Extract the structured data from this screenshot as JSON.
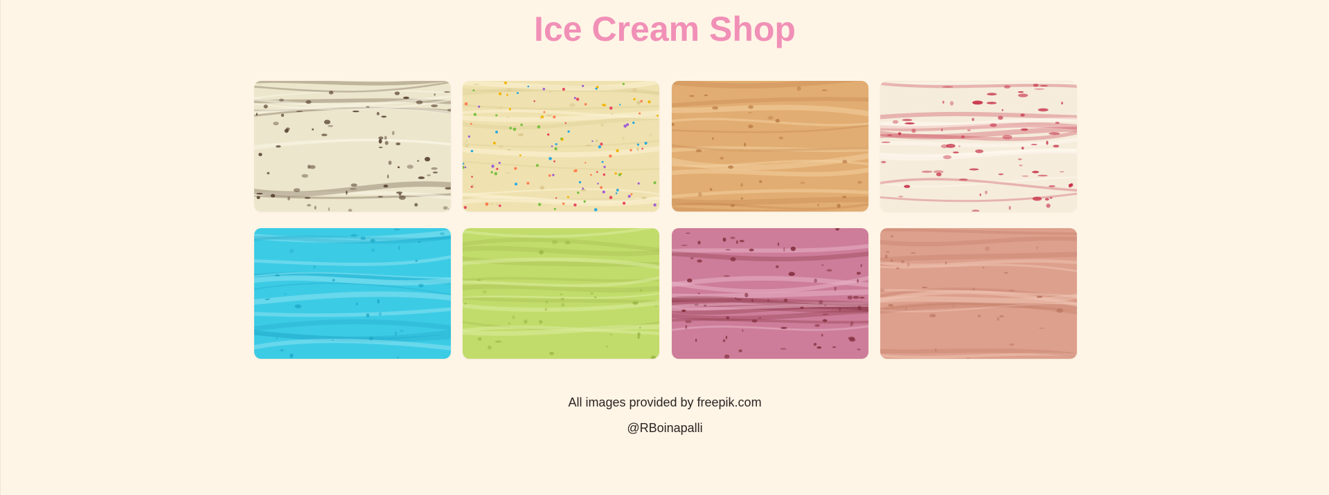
{
  "header": {
    "title": "Ice Cream Shop"
  },
  "colors": {
    "background": "#fff5e6",
    "title": "#f190b7",
    "footer_text": "#2b2323"
  },
  "gallery": {
    "items": [
      {
        "name": "chocolate-chip-ice-cream-image",
        "base": "#ece6cc",
        "accent": "#4a3322",
        "highlight": "#faf6e6"
      },
      {
        "name": "sprinkles-vanilla-ice-cream-image",
        "base": "#efe2b0",
        "accent": "#d9c58a",
        "highlight": "#fbf3d5"
      },
      {
        "name": "caramel-ice-cream-image",
        "base": "#e2ad72",
        "accent": "#b97b44",
        "highlight": "#f3cf9e"
      },
      {
        "name": "strawberry-ripple-ice-cream-image",
        "base": "#f5ecdc",
        "accent": "#c3213b",
        "highlight": "#fffaf0"
      },
      {
        "name": "blue-ice-cream-image",
        "base": "#3ccbe5",
        "accent": "#18a3c4",
        "highlight": "#8ce3f2"
      },
      {
        "name": "pistachio-ice-cream-image",
        "base": "#c2dc6c",
        "accent": "#99b443",
        "highlight": "#dcec9e"
      },
      {
        "name": "berry-pink-ice-cream-image",
        "base": "#cd7d99",
        "accent": "#7d2836",
        "highlight": "#e7b3c6"
      },
      {
        "name": "peach-ice-cream-image",
        "base": "#dda08d",
        "accent": "#b9745f",
        "highlight": "#efc3b3"
      }
    ]
  },
  "footer": {
    "credit": "All images provided by freepik.com",
    "handle": "@RBoinapalli"
  }
}
